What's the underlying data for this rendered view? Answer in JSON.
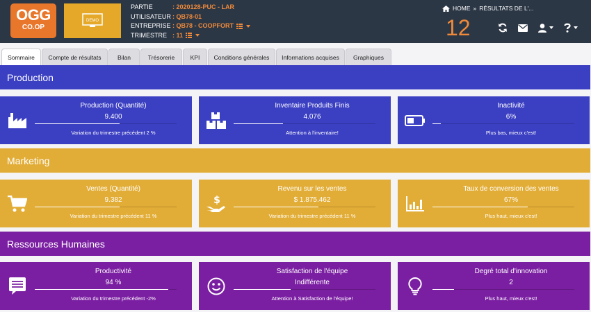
{
  "header": {
    "logo": {
      "line1": "OGG",
      "line2": "CO.OP"
    },
    "demo_label": "DEMO",
    "info": [
      {
        "key": "PARTIE",
        "value": ": 2020128-PUC - LAR"
      },
      {
        "key": "UTILISATEUR",
        "value": ": QB78-01"
      },
      {
        "key": "ENTREPRISE",
        "value": ": QB78 - COOPFORT"
      },
      {
        "key": "TRIMESTRE",
        "value": ": 11"
      }
    ],
    "breadcrumb": {
      "home": "HOME",
      "sep": "»",
      "current": "RÉSULTATS DE L'..."
    },
    "big_number": "12"
  },
  "tabs": [
    {
      "label": "Sommaire",
      "active": true
    },
    {
      "label": "Compte de résultats",
      "active": false
    },
    {
      "label": "Bilan",
      "active": false
    },
    {
      "label": "Trésorerie",
      "active": false
    },
    {
      "label": "KPI",
      "active": false
    },
    {
      "label": "Conditions générales",
      "active": false
    },
    {
      "label": "Informations acquises",
      "active": false
    },
    {
      "label": "Graphiques",
      "active": false
    }
  ],
  "sections": [
    {
      "title": "Production",
      "band_color": "#3b3fc2",
      "card_color": "#3b3fc2",
      "cards": [
        {
          "icon": "factory-icon",
          "title": "Production (Quantité)",
          "value": "9.400",
          "progress": 0.6,
          "sub": "Variation du trimestre précédent 2 %"
        },
        {
          "icon": "boxes-icon",
          "title": "Inventaire Produits Finis",
          "value": "4.076",
          "progress": 0.35,
          "sub": "Attention à l'inventaire!"
        },
        {
          "icon": "battery-icon",
          "title": "Inactivité",
          "value": "6%",
          "progress": 0.06,
          "sub": "Plus bas, mieux c'est!"
        }
      ]
    },
    {
      "title": "Marketing",
      "band_color": "#e2ad36",
      "card_color": "#e2ad36",
      "cards": [
        {
          "icon": "cart-icon",
          "title": "Ventes (Quantité)",
          "value": "9.382",
          "progress": 0.6,
          "sub": "Variation du trimestre précédent 11 %"
        },
        {
          "icon": "money-hand-icon",
          "title": "Revenu sur les ventes",
          "value": "$ 1.875.462",
          "progress": 0.6,
          "sub": "Variation du trimestre précédent 11 %"
        },
        {
          "icon": "bar-chart-icon",
          "title": "Taux de conversion des ventes",
          "value": "67%",
          "progress": 0.67,
          "sub": "Plus haut, mieux c'est!"
        }
      ]
    },
    {
      "title": "Ressources Humaines",
      "band_color": "#7b1fa2",
      "card_color": "#7b1fa2",
      "cards": [
        {
          "icon": "comment-icon",
          "title": "Productivité",
          "value": "94 %",
          "progress": 0.94,
          "sub": "Variation du trimestre précédent -2%"
        },
        {
          "icon": "smile-icon",
          "title": "Satisfaction de l'équipe",
          "value": "Indifférente",
          "progress": 0.4,
          "sub": "Attention à Satisfaction de l'équipe!"
        },
        {
          "icon": "lightbulb-icon",
          "title": "Degré total d'innovation",
          "value": "2",
          "progress": 0.15,
          "sub": "Plus haut, mieux c'est!"
        }
      ]
    }
  ]
}
